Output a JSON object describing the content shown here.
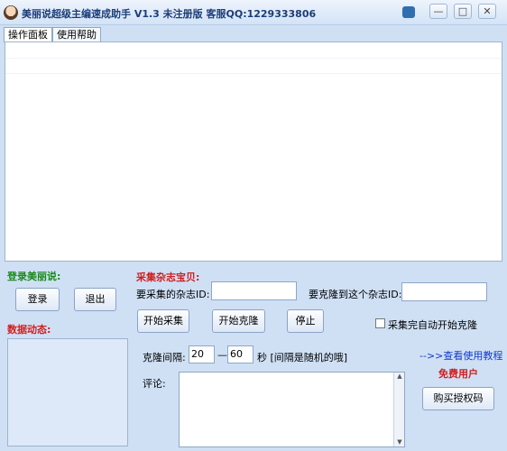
{
  "window": {
    "title": "美丽说超级主编速成助手 V1.3 未注册版 客服QQ:1229333806",
    "controls": {
      "minimize": "—",
      "maximize": "□",
      "close": "✕"
    }
  },
  "tabs": [
    {
      "label": "操作面板"
    },
    {
      "label": "使用帮助"
    }
  ],
  "login": {
    "heading": "登录美丽说:",
    "login_button": "登录",
    "exit_button": "退出"
  },
  "data_dynamic": {
    "heading": "数据动态:"
  },
  "collect": {
    "heading": "采集杂志宝贝:",
    "source_label": "要采集的杂志ID:",
    "source_value": "",
    "target_label": "要克隆到这个杂志ID:",
    "target_value": "",
    "start_collect_button": "开始采集",
    "start_clone_button": "开始克隆",
    "stop_button": "停止",
    "auto_clone_label": "采集完自动开始克隆",
    "auto_clone_checked": false
  },
  "interval": {
    "label": "克隆间隔:",
    "min": "20",
    "dash": "—",
    "max": "60",
    "unit_note": "秒 [间隔是随机的哦]"
  },
  "comment": {
    "label": "评论:",
    "value": ""
  },
  "help_link": "-->>查看使用教程",
  "user_status": "免费用户",
  "buy_button": "购买授权码"
}
